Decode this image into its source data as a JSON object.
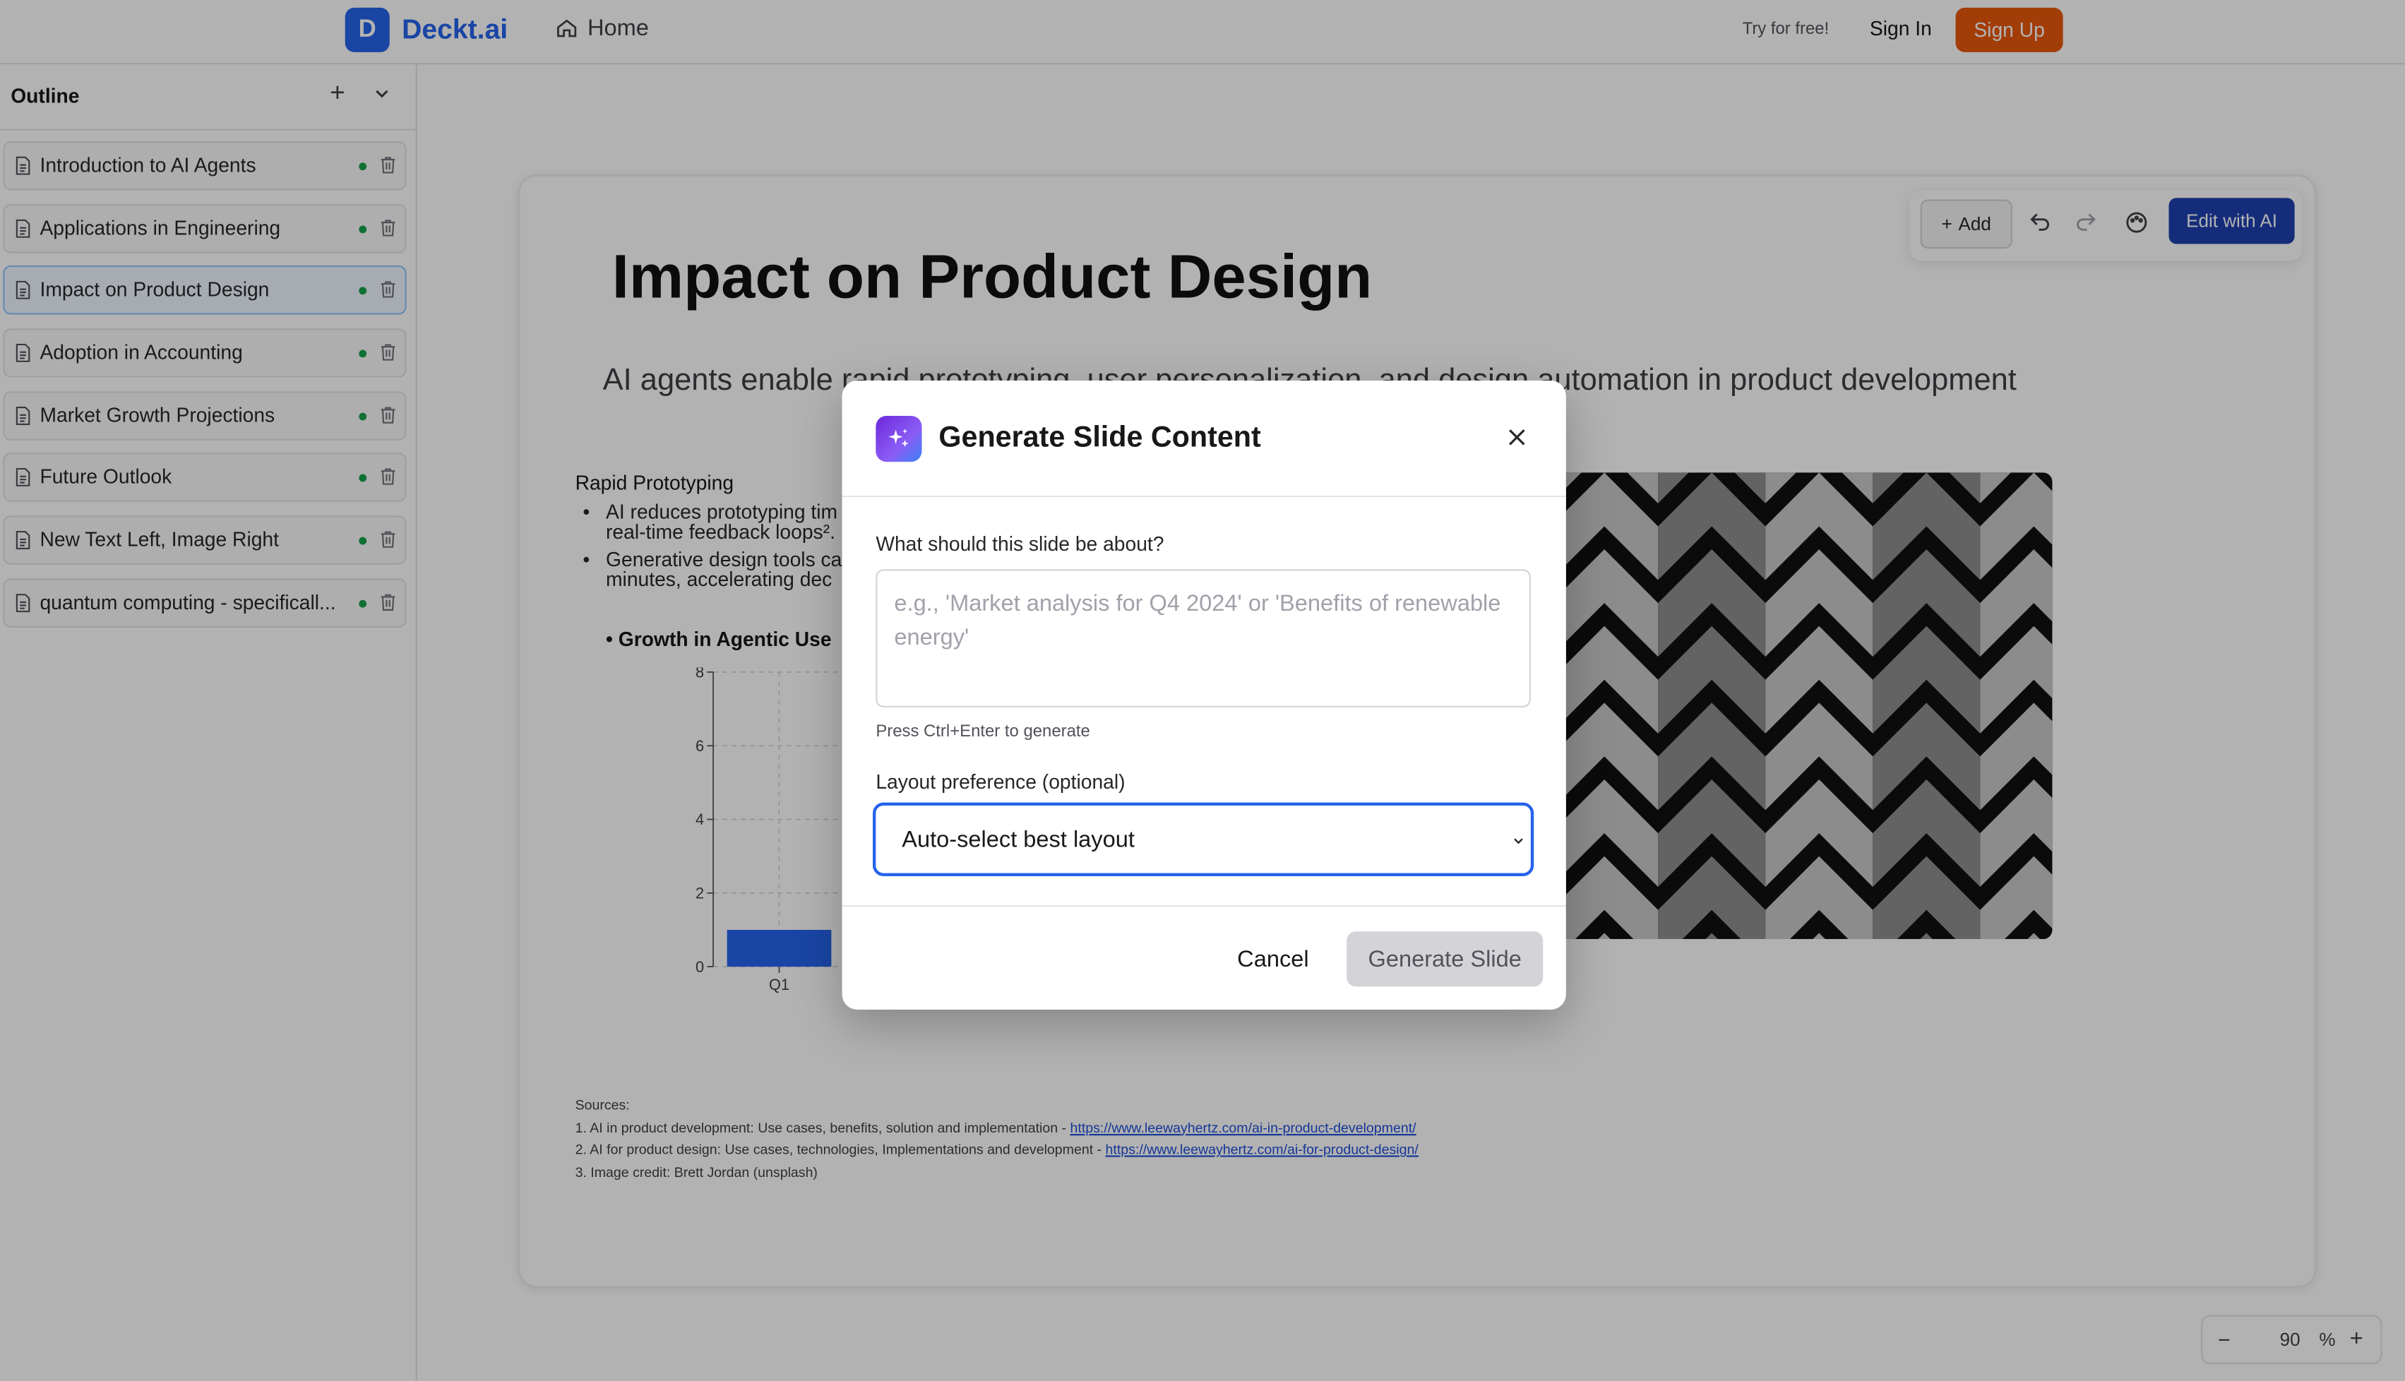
{
  "brand": {
    "badge": "D",
    "name": "Deckt.ai"
  },
  "nav": {
    "home": "Home",
    "try_free": "Try for free!",
    "sign_in": "Sign In",
    "sign_up": "Sign Up"
  },
  "sidebar": {
    "title": "Outline",
    "items": [
      {
        "label": "Introduction to AI Agents"
      },
      {
        "label": "Applications in Engineering"
      },
      {
        "label": "Impact on Product Design",
        "active": true
      },
      {
        "label": "Adoption in Accounting"
      },
      {
        "label": "Market Growth Projections"
      },
      {
        "label": "Future Outlook"
      },
      {
        "label": "New Text Left, Image Right"
      },
      {
        "label": "quantum computing - specificall..."
      }
    ]
  },
  "toolbar": {
    "add_label": "Add",
    "edit_ai_label": "Edit with AI"
  },
  "slide": {
    "title": "Impact on Product Design",
    "subtitle": "AI agents enable rapid prototyping, user personalization, and design automation in product development",
    "section_heading": "Rapid Prototyping",
    "bullets": [
      "AI reduces prototyping tim... real-time feedback loops².",
      "Generative design tools ca... minutes, accelerating dec..."
    ],
    "bullet_line1": [
      "AI reduces prototyping tim",
      "Generative design tools ca"
    ],
    "bullet_line2": [
      "real-time feedback loops².",
      "minutes, accelerating dec"
    ],
    "chart_heading": "Growth in Agentic Use",
    "sources_label": "Sources:",
    "sources": [
      {
        "text": "1. AI in product development: Use cases, benefits, solution and implementation - ",
        "link": "https://www.leewayhertz.com/ai-in-product-development/"
      },
      {
        "text": "2. AI for product design: Use cases, technologies, Implementations and development - ",
        "link": "https://www.leewayhertz.com/ai-for-product-design/"
      },
      {
        "text": "3. Image credit: Brett Jordan (unsplash)",
        "link": ""
      }
    ]
  },
  "chart_data": {
    "type": "bar",
    "title": "Growth in Agentic Use",
    "categories": [
      "Q1"
    ],
    "values": [
      1
    ],
    "ylim": [
      0,
      8
    ],
    "yticks": [
      "0",
      "2",
      "4",
      "6",
      "8"
    ],
    "grid": true,
    "color": "#2563eb"
  },
  "zoom": {
    "value": "90",
    "unit": "%"
  },
  "modal": {
    "title": "Generate Slide Content",
    "topic_label": "What should this slide be about?",
    "topic_value": "",
    "topic_placeholder": "e.g., 'Market analysis for Q4 2024' or 'Benefits of renewable energy'",
    "hint": "Press Ctrl+Enter to generate",
    "layout_label": "Layout preference (optional)",
    "layout_value": "Auto-select best layout",
    "cancel_label": "Cancel",
    "generate_label": "Generate Slide"
  },
  "colors": {
    "accent": "#2563eb",
    "signup": "#ea580c",
    "edit_ai": "#1e40af",
    "status_dot": "#16a34a"
  }
}
